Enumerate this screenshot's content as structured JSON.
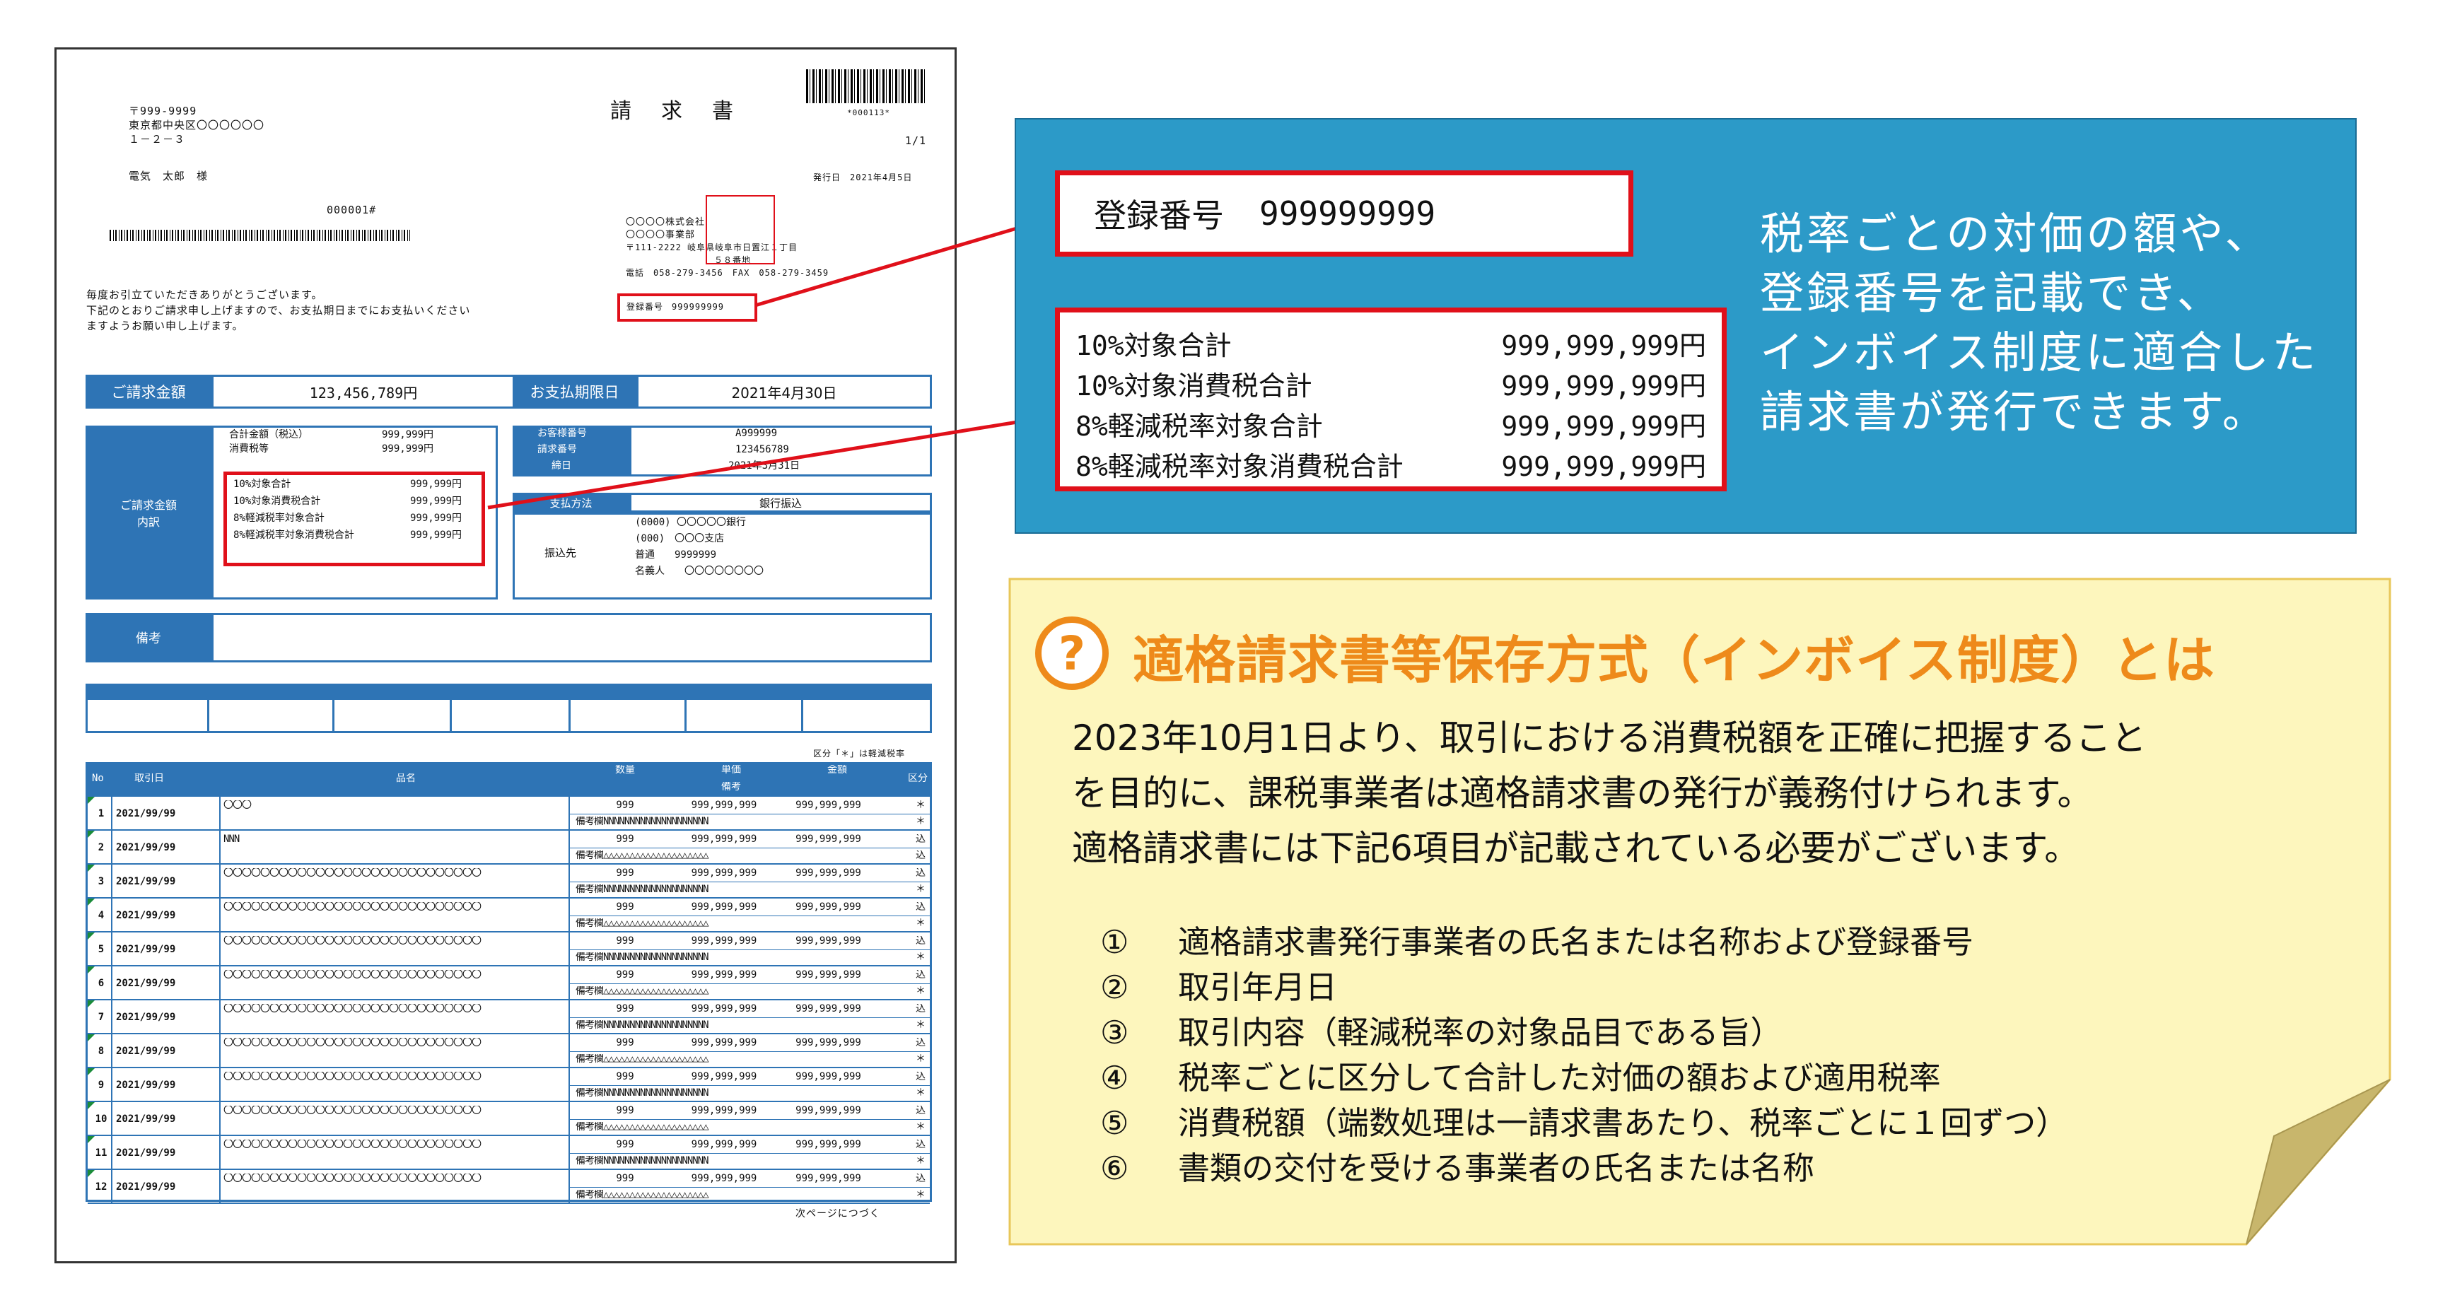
{
  "invoice": {
    "postal": "〒999-9999",
    "address1": "東京都中央区〇〇〇〇〇〇",
    "address2": "１－２－３",
    "recipient": "電気　太郎　様",
    "barcode_text": "*000113*",
    "title": "請　求　書",
    "page": "1/1",
    "issue_date": "発行日　2021年4月5日",
    "customer_no": "000001#",
    "company_name": "〇〇〇〇株式会社",
    "company_branch": "〇〇〇〇事業部",
    "company_address": "〒111-2222 岐阜県岐阜市日置江１丁目",
    "company_address2": "５８番地",
    "company_tel": "電話　058-279-3456　FAX　058-279-3459",
    "reg_label": "登録番号",
    "reg_value": "999999999",
    "greeting1": "毎度お引立ていただきありがとうございます。",
    "greeting2": "下記のとおりご請求申し上げますので、お支払期日までにお支払いください",
    "greeting3": "ますようお願い申し上げます。",
    "total_label": "ご請求金額",
    "total_value": "123,456,789円",
    "due_label": "お支払期限日",
    "due_value": "2021年4月30日",
    "breakdown_label": "ご請求金額\n内訳",
    "breakdown": [
      {
        "label": "合計金額（税込）",
        "value": "999,999円"
      },
      {
        "label": "消費税等",
        "value": "999,999円"
      }
    ],
    "tax_rows": [
      {
        "label": "10%対象合計",
        "value": "999,999円"
      },
      {
        "label": "10%対象消費税合計",
        "value": "999,999円"
      },
      {
        "label": "8%軽減税率対象合計",
        "value": "999,999円"
      },
      {
        "label": "8%軽減税率対象消費税合計",
        "value": "999,999円"
      }
    ],
    "info_rows": [
      {
        "label": "お客様番号",
        "value": "A999999"
      },
      {
        "label": "請求番号",
        "value": "123456789"
      },
      {
        "label": "締日",
        "value": "2021年3月31日"
      }
    ],
    "payment_method_label": "支払方法",
    "payment_method_value": "銀行振込",
    "payee_label": "振込先",
    "payee_lines": [
      "(0000) 〇〇〇〇〇銀行",
      "(000)　〇〇〇支店",
      "普通　　9999999",
      "名義人　　〇〇〇〇〇〇〇〇"
    ],
    "remarks_label": "備考",
    "table_note": "区分「＊」は軽減税率",
    "table_headers": [
      "No",
      "取引日",
      "品名",
      "数量",
      "単価",
      "金額",
      "区分"
    ],
    "table_subheader": "備考",
    "rows": [
      {
        "no": "1",
        "date": "2021/99/99",
        "name": "〇〇〇",
        "qty": "999",
        "unit": "999,999,999",
        "amount": "999,999,999",
        "kubun": "＊",
        "remark": "備考欄NNNNNNNNNNNNNNNNNNNN",
        "remark_kubun": "＊"
      },
      {
        "no": "2",
        "date": "2021/99/99",
        "name": "NNN",
        "qty": "999",
        "unit": "999,999,999",
        "amount": "999,999,999",
        "kubun": "込",
        "remark": "備考欄△△△△△△△△△△△△△△△△△△△△",
        "remark_kubun": "込"
      },
      {
        "no": "3",
        "date": "2021/99/99",
        "name": "〇〇〇〇〇〇〇〇〇〇〇〇〇〇〇〇〇〇〇〇〇〇〇〇〇〇〇〇",
        "qty": "999",
        "unit": "999,999,999",
        "amount": "999,999,999",
        "kubun": "込",
        "remark": "備考欄NNNNNNNNNNNNNNNNNNNN",
        "remark_kubun": "＊"
      },
      {
        "no": "4",
        "date": "2021/99/99",
        "name": "〇〇〇〇〇〇〇〇〇〇〇〇〇〇〇〇〇〇〇〇〇〇〇〇〇〇〇〇",
        "qty": "999",
        "unit": "999,999,999",
        "amount": "999,999,999",
        "kubun": "込",
        "remark": "備考欄△△△△△△△△△△△△△△△△△△△△",
        "remark_kubun": "＊"
      },
      {
        "no": "5",
        "date": "2021/99/99",
        "name": "〇〇〇〇〇〇〇〇〇〇〇〇〇〇〇〇〇〇〇〇〇〇〇〇〇〇〇〇",
        "qty": "999",
        "unit": "999,999,999",
        "amount": "999,999,999",
        "kubun": "込",
        "remark": "備考欄NNNNNNNNNNNNNNNNNNNN",
        "remark_kubun": "＊"
      },
      {
        "no": "6",
        "date": "2021/99/99",
        "name": "〇〇〇〇〇〇〇〇〇〇〇〇〇〇〇〇〇〇〇〇〇〇〇〇〇〇〇〇",
        "qty": "999",
        "unit": "999,999,999",
        "amount": "999,999,999",
        "kubun": "込",
        "remark": "備考欄△△△△△△△△△△△△△△△△△△△△",
        "remark_kubun": "＊"
      },
      {
        "no": "7",
        "date": "2021/99/99",
        "name": "〇〇〇〇〇〇〇〇〇〇〇〇〇〇〇〇〇〇〇〇〇〇〇〇〇〇〇〇",
        "qty": "999",
        "unit": "999,999,999",
        "amount": "999,999,999",
        "kubun": "込",
        "remark": "備考欄NNNNNNNNNNNNNNNNNNNN",
        "remark_kubun": "＊"
      },
      {
        "no": "8",
        "date": "2021/99/99",
        "name": "〇〇〇〇〇〇〇〇〇〇〇〇〇〇〇〇〇〇〇〇〇〇〇〇〇〇〇〇",
        "qty": "999",
        "unit": "999,999,999",
        "amount": "999,999,999",
        "kubun": "込",
        "remark": "備考欄△△△△△△△△△△△△△△△△△△△△",
        "remark_kubun": "＊"
      },
      {
        "no": "9",
        "date": "2021/99/99",
        "name": "〇〇〇〇〇〇〇〇〇〇〇〇〇〇〇〇〇〇〇〇〇〇〇〇〇〇〇〇",
        "qty": "999",
        "unit": "999,999,999",
        "amount": "999,999,999",
        "kubun": "込",
        "remark": "備考欄NNNNNNNNNNNNNNNNNNNN",
        "remark_kubun": "＊"
      },
      {
        "no": "10",
        "date": "2021/99/99",
        "name": "〇〇〇〇〇〇〇〇〇〇〇〇〇〇〇〇〇〇〇〇〇〇〇〇〇〇〇〇",
        "qty": "999",
        "unit": "999,999,999",
        "amount": "999,999,999",
        "kubun": "込",
        "remark": "備考欄△△△△△△△△△△△△△△△△△△△△",
        "remark_kubun": "＊"
      },
      {
        "no": "11",
        "date": "2021/99/99",
        "name": "〇〇〇〇〇〇〇〇〇〇〇〇〇〇〇〇〇〇〇〇〇〇〇〇〇〇〇〇",
        "qty": "999",
        "unit": "999,999,999",
        "amount": "999,999,999",
        "kubun": "込",
        "remark": "備考欄NNNNNNNNNNNNNNNNNNNN",
        "remark_kubun": "＊"
      },
      {
        "no": "12",
        "date": "2021/99/99",
        "name": "〇〇〇〇〇〇〇〇〇〇〇〇〇〇〇〇〇〇〇〇〇〇〇〇〇〇〇〇",
        "qty": "999",
        "unit": "999,999,999",
        "amount": "999,999,999",
        "kubun": "込",
        "remark": "備考欄△△△△△△△△△△△△△△△△△△△△",
        "remark_kubun": "＊"
      }
    ],
    "continue_note": "次ページにつづく"
  },
  "callout": {
    "reg_label": "登録番号",
    "reg_value": "999999999",
    "tax_rows": [
      {
        "label": "10%対象合計",
        "value": "999,999,999円"
      },
      {
        "label": "10%対象消費税合計",
        "value": "999,999,999円"
      },
      {
        "label": "8%軽減税率対象合計",
        "value": "999,999,999円"
      },
      {
        "label": "8%軽減税率対象消費税合計",
        "value": "999,999,999円"
      }
    ],
    "description_lines": [
      "税率ごとの対価の額や、",
      "登録番号を記載でき、",
      "インボイス制度に適合した",
      "請求書が発行できます。"
    ]
  },
  "note": {
    "icon": "?",
    "title": "適格請求書等保存方式（インボイス制度）とは",
    "body_lines": [
      "2023年10月1日より、取引における消費税額を正確に把握すること",
      "を目的に、課税事業者は適格請求書の発行が義務付けられます。",
      "適格請求書には下記6項目が記載されている必要がございます。"
    ],
    "items": [
      {
        "num": "①",
        "text": "適格請求書発行事業者の氏名または名称および登録番号"
      },
      {
        "num": "②",
        "text": "取引年月日"
      },
      {
        "num": "③",
        "text": "取引内容（軽減税率の対象品目である旨）"
      },
      {
        "num": "④",
        "text": "税率ごとに区分して合計した対価の額および適用税率"
      },
      {
        "num": "⑤",
        "text": "消費税額（端数処理は一請求書あたり、税率ごとに１回ずつ）"
      },
      {
        "num": "⑥",
        "text": "書類の交付を受ける事業者の氏名または名称"
      }
    ]
  },
  "colors": {
    "doc_blue": "#2e74b5",
    "callout_blue": "#2c9ac8",
    "highlight_red": "#e0101a",
    "note_yellow": "#fdf6bd",
    "note_orange": "#ee8a1a"
  }
}
